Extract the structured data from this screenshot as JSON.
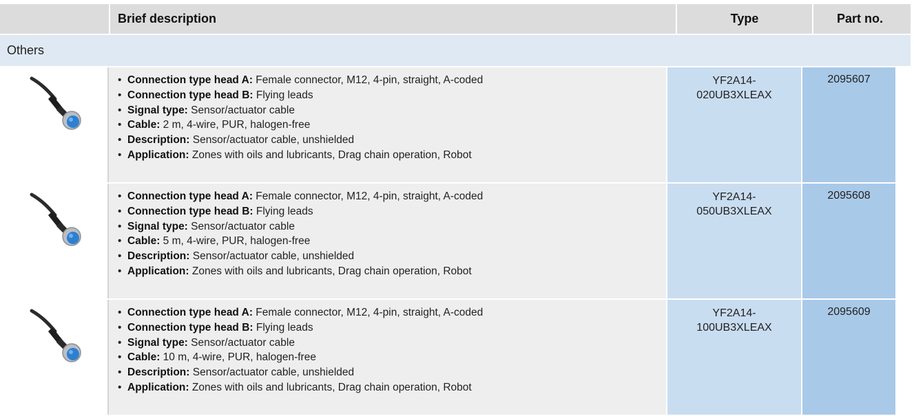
{
  "header": {
    "col_image": "",
    "col_description": "Brief description",
    "col_type": "Type",
    "col_part": "Part no."
  },
  "group": {
    "label": "Others"
  },
  "products": [
    {
      "image_icon": "cable-connector-icon",
      "type_line1": "YF2A14-",
      "type_line2": "020UB3XLEAX",
      "part_no": "2095607",
      "specs": [
        {
          "label": "Connection type head A:",
          "value": " Female connector, M12, 4-pin, straight, A-coded"
        },
        {
          "label": "Connection type head B:",
          "value": " Flying leads"
        },
        {
          "label": "Signal type:",
          "value": " Sensor/actuator cable"
        },
        {
          "label": "Cable:",
          "value": " 2 m, 4-wire, PUR, halogen-free"
        },
        {
          "label": "Description:",
          "value": " Sensor/actuator cable, unshielded"
        },
        {
          "label": "Application:",
          "value": " Zones with oils and lubricants, Drag chain operation, Robot"
        }
      ]
    },
    {
      "image_icon": "cable-connector-icon",
      "type_line1": "YF2A14-",
      "type_line2": "050UB3XLEAX",
      "part_no": "2095608",
      "specs": [
        {
          "label": "Connection type head A:",
          "value": " Female connector, M12, 4-pin, straight, A-coded"
        },
        {
          "label": "Connection type head B:",
          "value": " Flying leads"
        },
        {
          "label": "Signal type:",
          "value": " Sensor/actuator cable"
        },
        {
          "label": "Cable:",
          "value": " 5 m, 4-wire, PUR, halogen-free"
        },
        {
          "label": "Description:",
          "value": " Sensor/actuator cable, unshielded"
        },
        {
          "label": "Application:",
          "value": " Zones with oils and lubricants, Drag chain operation, Robot"
        }
      ]
    },
    {
      "image_icon": "cable-connector-icon",
      "type_line1": "YF2A14-",
      "type_line2": "100UB3XLEAX",
      "part_no": "2095609",
      "specs": [
        {
          "label": "Connection type head A:",
          "value": " Female connector, M12, 4-pin, straight, A-coded"
        },
        {
          "label": "Connection type head B:",
          "value": " Flying leads"
        },
        {
          "label": "Signal type:",
          "value": " Sensor/actuator cable"
        },
        {
          "label": "Cable:",
          "value": " 10 m, 4-wire, PUR, halogen-free"
        },
        {
          "label": "Description:",
          "value": " Sensor/actuator cable, unshielded"
        },
        {
          "label": "Application:",
          "value": " Zones with oils and lubricants, Drag chain operation, Robot"
        }
      ]
    }
  ],
  "colors": {
    "header_bg": "#dcdcdc",
    "group_bg": "#dfe9f3",
    "desc_bg": "#eeeeee",
    "type_bg": "#c9ddf0",
    "part_bg": "#a9c9e8",
    "connector_blue": "#2f7fd0"
  }
}
